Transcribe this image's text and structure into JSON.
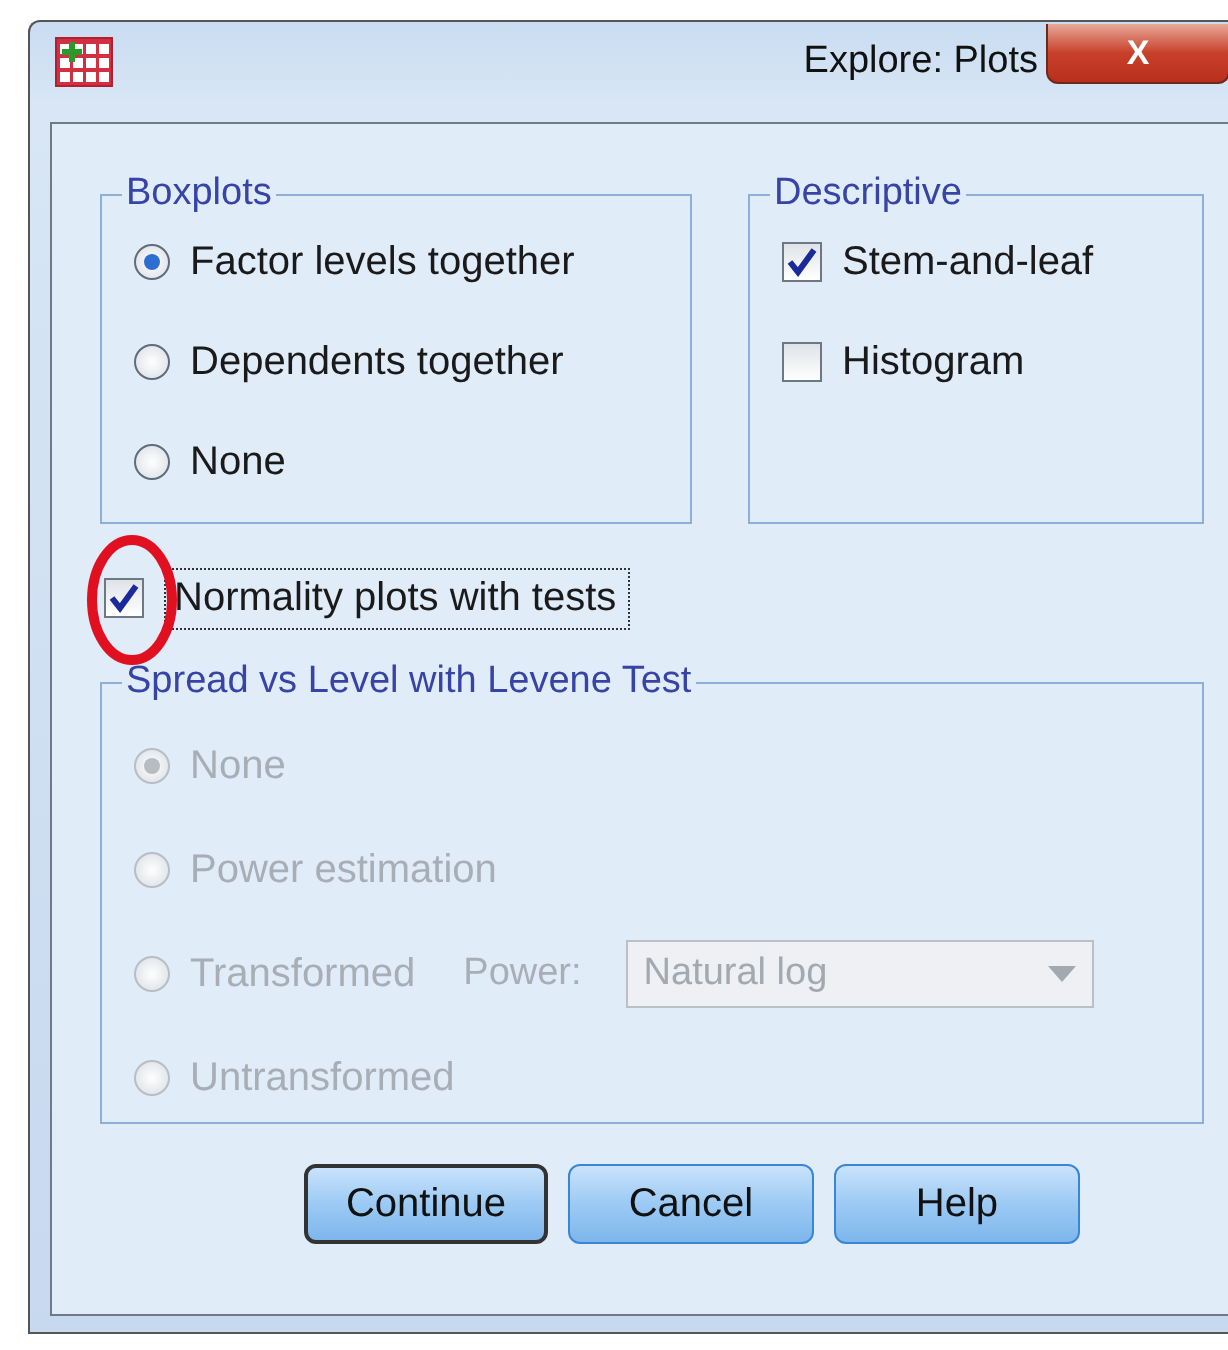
{
  "window": {
    "title": "Explore: Plots",
    "close": "X"
  },
  "boxplots": {
    "title": "Boxplots",
    "options": [
      {
        "label": "Factor levels together",
        "selected": true
      },
      {
        "label": "Dependents together",
        "selected": false
      },
      {
        "label": "None",
        "selected": false
      }
    ]
  },
  "descriptive": {
    "title": "Descriptive",
    "options": [
      {
        "label": "Stem-and-leaf",
        "checked": true
      },
      {
        "label": "Histogram",
        "checked": false
      }
    ]
  },
  "normality": {
    "label": "Normality plots with tests",
    "checked": true,
    "focused": true,
    "circled": true
  },
  "spread_vs_level": {
    "title": "Spread vs Level with Levene Test",
    "disabled": true,
    "options": [
      {
        "label": "None",
        "selected": true
      },
      {
        "label": "Power estimation",
        "selected": false
      },
      {
        "label": "Transformed",
        "selected": false,
        "kind": "power"
      },
      {
        "label": "Untransformed",
        "selected": false
      }
    ],
    "power_label": "Power:",
    "power_value": "Natural log"
  },
  "buttons": [
    {
      "label": "Continue",
      "default": true
    },
    {
      "label": "Cancel",
      "default": false
    },
    {
      "label": "Help",
      "default": false
    }
  ]
}
